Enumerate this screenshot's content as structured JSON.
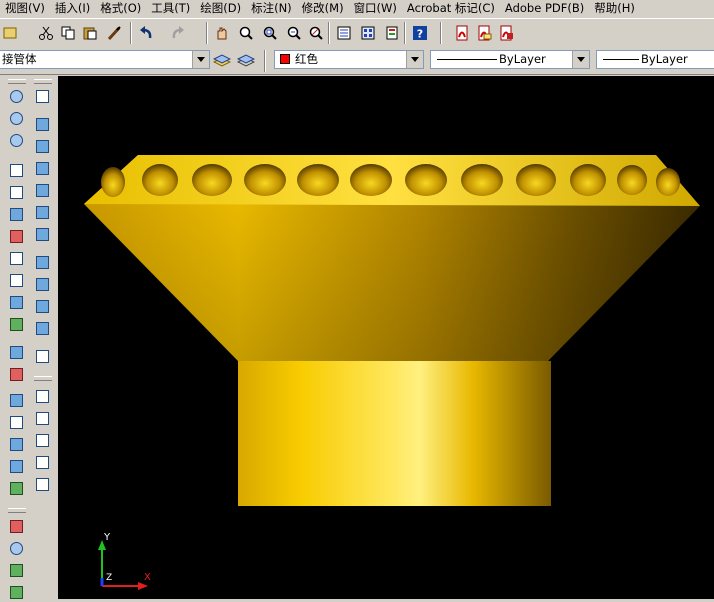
{
  "menu": [
    {
      "label": "视图(V)"
    },
    {
      "label": "插入(I)"
    },
    {
      "label": "格式(O)"
    },
    {
      "label": "工具(T)"
    },
    {
      "label": "绘图(D)"
    },
    {
      "label": "标注(N)"
    },
    {
      "label": "修改(M)"
    },
    {
      "label": "窗口(W)"
    },
    {
      "label": "Acrobat 标记(C)"
    },
    {
      "label": "Adobe PDF(B)"
    },
    {
      "label": "帮助(H)"
    }
  ],
  "toolbar": {
    "icons": [
      "layer-icon",
      "cut-icon",
      "copy-icon",
      "paste-icon",
      "match-properties-icon",
      "undo-icon",
      "redo-icon",
      "pan-icon",
      "zoom-realtime-icon",
      "zoom-window-icon",
      "zoom-previous-icon",
      "named-view-icon",
      "properties-icon",
      "design-center-icon",
      "tool-palettes-icon",
      "help-icon",
      "pdf-convert-icon",
      "pdf-email-icon",
      "pdf-review-icon"
    ]
  },
  "properties": {
    "layer_value": "接管体",
    "color_value": "红色",
    "color_swatch": "#ff0000",
    "linetype_value": "ByLayer",
    "lineweight_value": "ByLayer"
  },
  "ucs": {
    "x_label": "X",
    "y_label": "Y",
    "z_label": "Z"
  },
  "colors": {
    "ui_face": "#d4d0c8",
    "viewport_bg": "#000000",
    "model_gold": "#f0c000",
    "axis_x": "#e02020",
    "axis_y": "#20c020",
    "axis_z": "#2040ff"
  }
}
